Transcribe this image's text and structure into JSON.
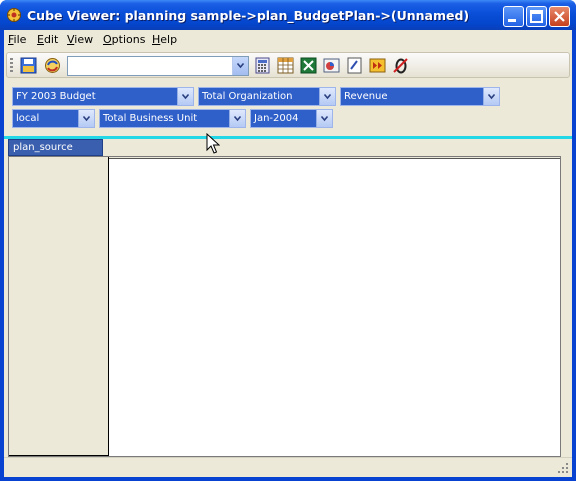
{
  "window": {
    "title": "Cube Viewer: planning sample->plan_BudgetPlan->(Unnamed)",
    "app_icon": "cube-viewer-icon",
    "controls": [
      "minimize",
      "maximize",
      "close"
    ]
  },
  "menu": {
    "items": [
      {
        "label": "File",
        "underline": "F",
        "rest": "ile"
      },
      {
        "label": "Edit",
        "underline": "E",
        "rest": "dit"
      },
      {
        "label": "View",
        "underline": "V",
        "rest": "iew"
      },
      {
        "label": "Options",
        "underline": "O",
        "rest": "ptions"
      },
      {
        "label": "Help",
        "underline": "H",
        "rest": "elp"
      }
    ]
  },
  "toolbar": {
    "icons": [
      "save-view-icon",
      "recalculate-icon",
      "calculator-icon",
      "table-icon",
      "excel-icon",
      "chart-icon",
      "edit-icon",
      "run-icon",
      "zero-suppress-icon"
    ],
    "view_combo_value": ""
  },
  "dimensions": {
    "row1": [
      "FY 2003 Budget",
      "Total Organization",
      "Revenue"
    ],
    "row2": [
      "local",
      "Total Business Unit",
      "Jan-2004"
    ]
  },
  "grid": {
    "row_dimension_tab": "plan_source"
  },
  "colors": {
    "dropdown_bg": "#2f5fc9",
    "title_bar": "#0a4fd8",
    "separator": "#24d7e6"
  }
}
